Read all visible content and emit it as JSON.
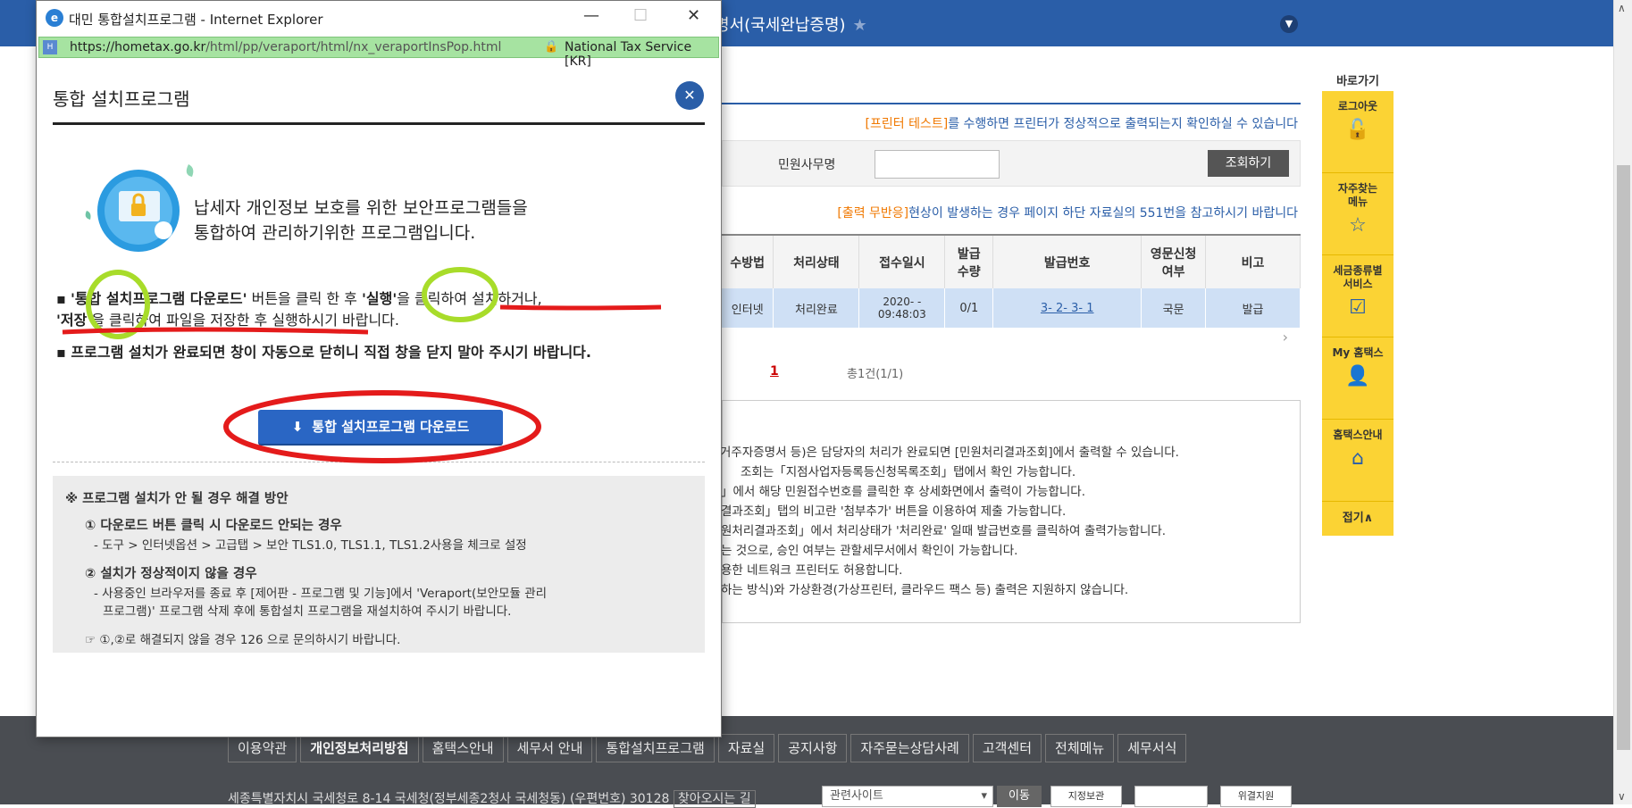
{
  "background": {
    "crumb": "명서(국세완납증명)",
    "notice_printer_hl": "[프린터 테스트]",
    "notice_printer_rest": "를 수행하면 프린터가 정상적으로 출력되는지 확인하실 수 있습니다",
    "search_label": "민원사무명",
    "search_value": "",
    "search_button": "조회하기",
    "notice_print_hl": "[출력 무반응]",
    "notice_print_rest": "현상이 발생하는 경우 페이지 하단 자료실의 551번을 참고하시기 바랍니다",
    "table": {
      "headers": [
        "수방법",
        "처리상태",
        "접수일시",
        "발급\n수량",
        "발급번호",
        "영문신청\n여부",
        "비고"
      ],
      "row": [
        "인터넷",
        "처리완료",
        "2020-  -\n09:48:03",
        "0/1",
        "3- 2- 3- 1",
        "국문",
        "발급"
      ]
    },
    "page_current": "1",
    "page_total": "총1건(1/1)",
    "info_lines": [
      "거주자증명서 등)은 담당자의 처리가 완료되면 [민원처리결과조회]에서 출력할 수 있습니다.",
      "조회는「지점사업자등록등신청목록조회」탭에서 확인 가능합니다.",
      "」에서 해당 민원접수번호를 클릭한 후 상세화면에서 출력이 가능합니다.",
      "결과조회」탭의 비고란 '첨부추가' 버튼을 이용하여 제출 가능합니다.",
      "원처리결과조회」에서 처리상태가 '처리완료' 일때 발급번호를 클릭하여 출력가능합니다.",
      "는 것으로, 승인 여부는 관할세무서에서 확인이 가능합니다.",
      "용한 네트워크 프린터도 허용합니다.",
      "하는 방식)와 가상환경(가상프린터, 클라우드 팩스 등) 출력은 지원하지 않습니다."
    ],
    "quick_title": "바로가기",
    "quick_items": [
      {
        "label": "로그아웃",
        "icon": "unlock-icon"
      },
      {
        "label": "자주찾는\n메뉴",
        "icon": "star-icon"
      },
      {
        "label": "세금종류별\n서비스",
        "icon": "checkbox-icon"
      },
      {
        "label": "My 홈택스",
        "icon": "person-icon"
      },
      {
        "label": "홈택스안내",
        "icon": "home-icon"
      }
    ],
    "quick_fold": "접기∧",
    "footer_links": [
      "이용약관",
      "개인정보처리방침",
      "홈택스안내",
      "세무서 안내",
      "통합설치프로그램",
      "자료실",
      "공지사항",
      "자주묻는상담사례",
      "고객센터",
      "전체메뉴",
      "세무서식"
    ],
    "footer_address": "세종특별자치시 국세청로 8-14 국세청(정부세종2청사 국세청동) (우편번호) 30128",
    "footer_directions": "찾아오시는 길",
    "footer_related": "관련사이트",
    "footer_go": "이동",
    "footer_badges": [
      "지정보관",
      "",
      "위결지원"
    ]
  },
  "popup": {
    "window_title": "대민 통합설치프로그램 - Internet Explorer",
    "url_main": "https://hometax.go.kr",
    "url_path": "/html/pp/veraport/html/nx_veraportInsPop.html",
    "security": "National Tax Service [KR]",
    "heading": "통합 설치프로그램",
    "desc_line1": "납세자 개인정보 보호를 위한 보안프로그램들을",
    "desc_line2": "통합하여 관리하기위한 프로그램입니다.",
    "bullet1_bold": "'통합 설치프로그램 다운로드'",
    "bullet1_mid": " 버튼을 클릭 한 후 ",
    "bullet1_run": "'실행'",
    "bullet1_after": "을 클릭하여 설치하거나,",
    "bullet1_save": "'저장'",
    "bullet1_tail": "을 클릭하여 파일을 저장한 후 실행하시기 바랍니다.",
    "bullet2": "프로그램 설치가 완료되면 창이 자동으로 닫히니 직접 창을 닫지 말아 주시기 바랍니다.",
    "download_button": "통합 설치프로그램 다운로드",
    "help_title": "※ 프로그램 설치가 안 될 경우 해결 방안",
    "help1_title": "① 다운로드 버튼 클릭 시 다운로드 안되는 경우",
    "help1_text": "- 도구 > 인터넷옵션 > 고급탭 > 보안 TLS1.0, TLS1.1, TLS1.2사용을 체크로 설정",
    "help2_title": "② 설치가 정상적이지 않을 경우",
    "help2_text1": "- 사용중인 브라우저를 종료 후 [제어판 - 프로그램 및 기능]에서 'Veraport(보안모듈 관리",
    "help2_text2": "프로그램)' 프로그램 삭제 후에 통합설치 프로그램을 재설치하여 주시기 바랍니다.",
    "help3": "①,②로 해결되지 않을 경우 126 으로 문의하시기 바랍니다."
  }
}
